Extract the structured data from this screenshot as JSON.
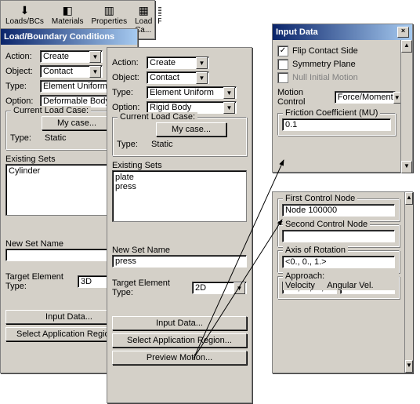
{
  "toolbar": {
    "items": [
      {
        "label": "Loads/BCs",
        "icon": "↓"
      },
      {
        "label": "Materials",
        "icon": "◧"
      },
      {
        "label": "Properties",
        "icon": "▥"
      },
      {
        "label": "Load Ca...",
        "icon": "▦"
      },
      {
        "label": "F",
        "icon": "▤"
      }
    ]
  },
  "panel1": {
    "title": "Load/Boundary Conditions",
    "action_lbl": "Action:",
    "action": "Create",
    "object_lbl": "Object:",
    "object": "Contact",
    "type_lbl": "Type:",
    "type": "Element Uniform",
    "option_lbl": "Option:",
    "option": "Deformable Body",
    "clc_lbl": "Current Load Case:",
    "clc_btn": "My case...",
    "clc_type_lbl": "Type:",
    "clc_type": "Static",
    "sets_lbl": "Existing Sets",
    "sets": [
      "Cylinder"
    ],
    "newset_lbl": "New Set Name",
    "newset": "",
    "tet_lbl": "Target Element Type:",
    "tet": "3D",
    "input_btn": "Input Data...",
    "region_btn": "Select Application Region..."
  },
  "panel2": {
    "action_lbl": "Action:",
    "action": "Create",
    "object_lbl": "Object:",
    "object": "Contact",
    "type_lbl": "Type:",
    "type": "Element Uniform",
    "option_lbl": "Option:",
    "option": "Rigid Body",
    "clc_lbl": "Current Load Case:",
    "clc_btn": "My case...",
    "clc_type_lbl": "Type:",
    "clc_type": "Static",
    "sets_lbl": "Existing Sets",
    "sets": [
      "plate",
      "press"
    ],
    "newset_lbl": "New Set Name",
    "newset": "press",
    "tet_lbl": "Target Element Type:",
    "tet": "2D",
    "input_btn": "Input Data...",
    "region_btn": "Select Application Region...",
    "preview_btn": "Preview Motion..."
  },
  "inputdata": {
    "title": "Input Data",
    "flip_lbl": "Flip Contact Side",
    "flip": true,
    "sym_lbl": "Symmetry Plane",
    "sym": false,
    "null_lbl": "Null Initial Motion",
    "null": false,
    "motion_lbl": "Motion Control",
    "motion": "Force/Moment",
    "fric_lbl": "Friction Coefficient (MU)",
    "fric": "0.1",
    "fcn_lbl": "First Control Node",
    "fcn": "Node 100000",
    "scn_lbl": "Second Control Node",
    "scn": "",
    "axis_lbl": "Axis of Rotation",
    "axis": "<0., 0., 1.>",
    "appr_lbl": "Approach: Velocity",
    "ang_lbl": "Angular Vel.",
    "appr": "<0., 0., 0.,>"
  }
}
